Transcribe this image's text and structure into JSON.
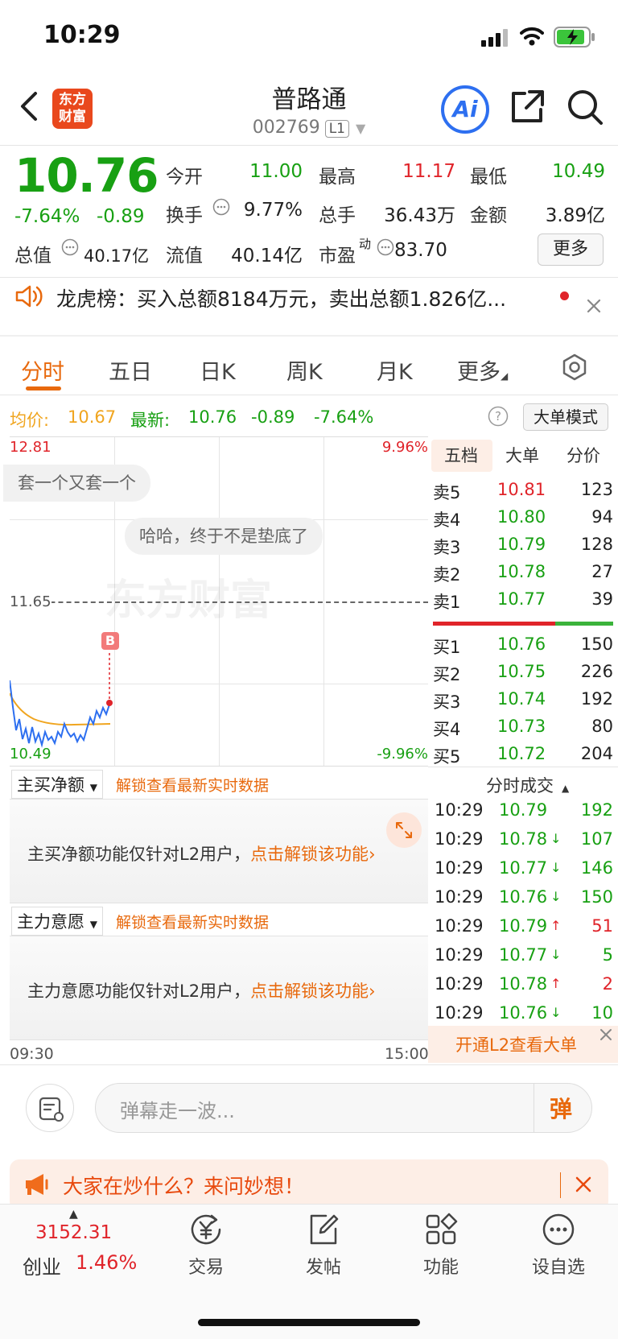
{
  "status": {
    "time": "10:29"
  },
  "header": {
    "name": "普路通",
    "code": "002769",
    "level": "L1",
    "logo": "东方\n财富",
    "ai": "Ai"
  },
  "quote": {
    "price": "10.76",
    "pct": "-7.64%",
    "change": "-0.89",
    "open_label": "今开",
    "open": "11.00",
    "high_label": "最高",
    "high": "11.17",
    "low_label": "最低",
    "low": "10.49",
    "turnover_label": "换手",
    "turnover": "9.77%",
    "volume_label": "总手",
    "volume": "36.43万",
    "amount_label": "金额",
    "amount": "3.89亿",
    "mktcap_label": "总值",
    "mktcap": "40.17亿",
    "float_label": "流值",
    "float": "40.14亿",
    "pe_label": "市盈",
    "pe_sup": "动",
    "pe": "83.70",
    "more": "更多"
  },
  "news": {
    "text": "龙虎榜：买入总额8184万元，卖出总额1.826亿..."
  },
  "tabs": [
    "分时",
    "五日",
    "日K",
    "周K",
    "月K",
    "更多"
  ],
  "avg_row": {
    "avg_label": "均价:",
    "avg": "10.67",
    "latest_label": "最新:",
    "latest": "10.76",
    "chg": "-0.89",
    "pct": "-7.64%",
    "mode": "大单模式"
  },
  "chart": {
    "max_price": "12.81",
    "max_pct": "9.96%",
    "ref": "11.65",
    "min_price": "10.49",
    "min_pct": "-9.96%",
    "bubble1": "套一个又套一个",
    "bubble2": "哈哈，终于不是垫底了",
    "watermark": "东方财富",
    "marker": "B",
    "time_start": "09:30",
    "time_end": "15:00"
  },
  "orderbook": {
    "tabs": [
      "五档",
      "大单",
      "分价"
    ],
    "asks": [
      {
        "label": "卖5",
        "price": "10.81",
        "vol": "123"
      },
      {
        "label": "卖4",
        "price": "10.80",
        "vol": "94"
      },
      {
        "label": "卖3",
        "price": "10.79",
        "vol": "128"
      },
      {
        "label": "卖2",
        "price": "10.78",
        "vol": "27"
      },
      {
        "label": "卖1",
        "price": "10.77",
        "vol": "39"
      }
    ],
    "bids": [
      {
        "label": "买1",
        "price": "10.76",
        "vol": "150"
      },
      {
        "label": "买2",
        "price": "10.75",
        "vol": "226"
      },
      {
        "label": "买3",
        "price": "10.74",
        "vol": "192"
      },
      {
        "label": "买4",
        "price": "10.73",
        "vol": "80"
      },
      {
        "label": "买5",
        "price": "10.72",
        "vol": "204"
      }
    ]
  },
  "trades": {
    "title": "分时成交",
    "rows": [
      {
        "time": "10:29",
        "price": "10.79",
        "arrow": "",
        "vol": "192",
        "dir": "up"
      },
      {
        "time": "10:29",
        "price": "10.78",
        "arrow": "↓",
        "vol": "107",
        "dir": "down"
      },
      {
        "time": "10:29",
        "price": "10.77",
        "arrow": "↓",
        "vol": "146",
        "dir": "down"
      },
      {
        "time": "10:29",
        "price": "10.76",
        "arrow": "↓",
        "vol": "150",
        "dir": "down"
      },
      {
        "time": "10:29",
        "price": "10.79",
        "arrow": "↑",
        "vol": "51",
        "dir": "up"
      },
      {
        "time": "10:29",
        "price": "10.77",
        "arrow": "↓",
        "vol": "5",
        "dir": "down"
      },
      {
        "time": "10:29",
        "price": "10.78",
        "arrow": "↑",
        "vol": "2",
        "dir": "up"
      },
      {
        "time": "10:29",
        "price": "10.76",
        "arrow": "↓",
        "vol": "10",
        "dir": "down"
      }
    ],
    "l2_cta": "开通L2查看大单"
  },
  "panels": {
    "p1_dropdown": "主买净额",
    "p1_unlock": "解锁查看最新实时数据",
    "p1_msg": "主买净额功能仅针对L2用户，",
    "p1_link": "点击解锁该功能",
    "p2_dropdown": "主力意愿",
    "p2_unlock": "解锁查看最新实时数据",
    "p2_msg": "主力意愿功能仅针对L2用户，",
    "p2_link": "点击解锁该功能"
  },
  "danmaku": {
    "placeholder": "弹幕走一波...",
    "btn": "弹"
  },
  "banner": {
    "text": "大家在炒什么？来问妙想！"
  },
  "bottom_nav": {
    "index_value": "3152.31",
    "index_name": "创业",
    "index_pct": "1.46%",
    "items": [
      "交易",
      "发帖",
      "功能",
      "设自选"
    ]
  },
  "colors": {
    "up": "#e0242a",
    "down": "#18a013",
    "accent": "#e8690d",
    "ai": "#2d6ff0"
  }
}
